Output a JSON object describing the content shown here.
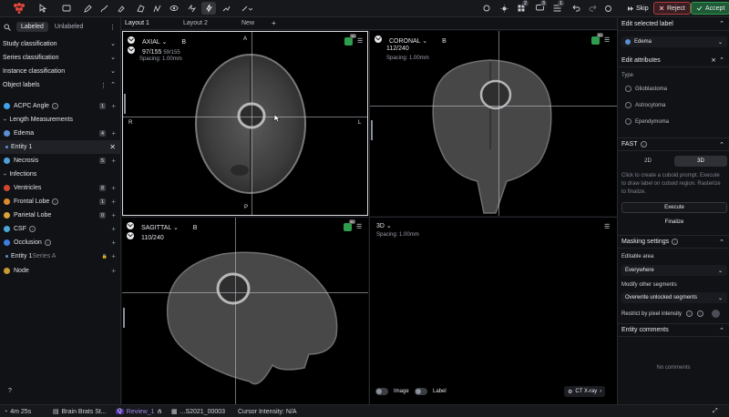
{
  "topbar": {
    "skip_label": "Skip",
    "reject_label": "Reject",
    "accept_label": "Accept",
    "notif_count_1": "3",
    "notif_count_2": "2",
    "notif_count_3": "1"
  },
  "tabs": [
    "Layout 1",
    "Layout 2",
    "New"
  ],
  "tab_add": "+",
  "left": {
    "search_tabs": [
      "Labeled",
      "Unlabeled"
    ],
    "sections": {
      "study": "Study classification",
      "series": "Series classification",
      "instance": "Instance classification",
      "object": "Object labels"
    },
    "labels": [
      {
        "name": "ACPC Angle",
        "count": "1",
        "color": "#3fa4e8",
        "info": true
      },
      {
        "name": "Length Measurements",
        "group": true
      },
      {
        "name": "Edema",
        "count": "4",
        "color": "#5b8fd4"
      },
      {
        "name": "Entity 1",
        "entity": true
      },
      {
        "name": "Necrosis",
        "count": "5",
        "color": "#4fa0d8"
      },
      {
        "name": "Infections",
        "group": true
      },
      {
        "name": "Ventricles",
        "count": "8",
        "color": "#d0472e"
      },
      {
        "name": "Frontal Lobe",
        "count": "1",
        "color": "#e08a30",
        "info": true
      },
      {
        "name": "Parietal Lobe",
        "count": "0",
        "color": "#d8a03a"
      },
      {
        "name": "CSF",
        "color": "#4aa6d4",
        "info": true
      },
      {
        "name": "Occlusion",
        "color": "#3d7ee0",
        "info": true
      },
      {
        "name": "Entity 1",
        "series": "Series A",
        "entity": true,
        "locked": true
      },
      {
        "name": "Node",
        "color": "#c89a30"
      }
    ],
    "help": "?"
  },
  "viewports": {
    "axial": {
      "name": "AXIAL",
      "tag": "B",
      "slice": "97/155",
      "slice_sub": "59/155",
      "spacing": "Spacing: 1.00mm",
      "orient_top": "A",
      "orient_bottom": "P",
      "orient_left": "R",
      "orient_right": "L"
    },
    "coronal": {
      "name": "CORONAL",
      "tag": "B",
      "slice": "112/240",
      "spacing": "Spacing: 1.00mm"
    },
    "sagittal": {
      "name": "SAGITTAL",
      "tag": "B",
      "slice": "110/240"
    },
    "three_d": {
      "name": "3D",
      "spacing": "Spacing: 1.00mm",
      "toggle_image": "Image",
      "toggle_label": "Label",
      "preset": "CT X-ray"
    },
    "badge_3d": "3D"
  },
  "right": {
    "edit_label_title": "Edit selected label",
    "selected_label": "Edema",
    "edit_attributes_title": "Edit attributes",
    "type_label": "Type",
    "types": [
      "Glioblastoma",
      "Astrocytoma",
      "Ependymoma"
    ],
    "fast_title": "FAST",
    "fast_modes": [
      "2D",
      "3D"
    ],
    "fast_help": "Click to create a cuboid prompt. Execute to draw label on cuboid region. Rasterize to finalize.",
    "execute": "Execute",
    "finalize": "Finalize",
    "masking_title": "Masking settings",
    "editable_area_label": "Editable area",
    "editable_area_value": "Everywhere",
    "modify_label": "Modify other segments",
    "modify_value": "Overwrite unlocked segments",
    "restrict_label": "Restrict by pixel intensity",
    "entity_comments_title": "Entity comments",
    "no_comments": "No comments"
  },
  "bottom": {
    "timer": "4m 25s",
    "dataset": "Brain Brats St...",
    "stage": "Review_1",
    "series_id": "...S2021_00003",
    "cursor": "Cursor Intensity: N/A"
  },
  "colors": {
    "accent_green": "#1f8a4a",
    "reject_red": "#b23a3a",
    "brand_red": "#e0473a"
  }
}
